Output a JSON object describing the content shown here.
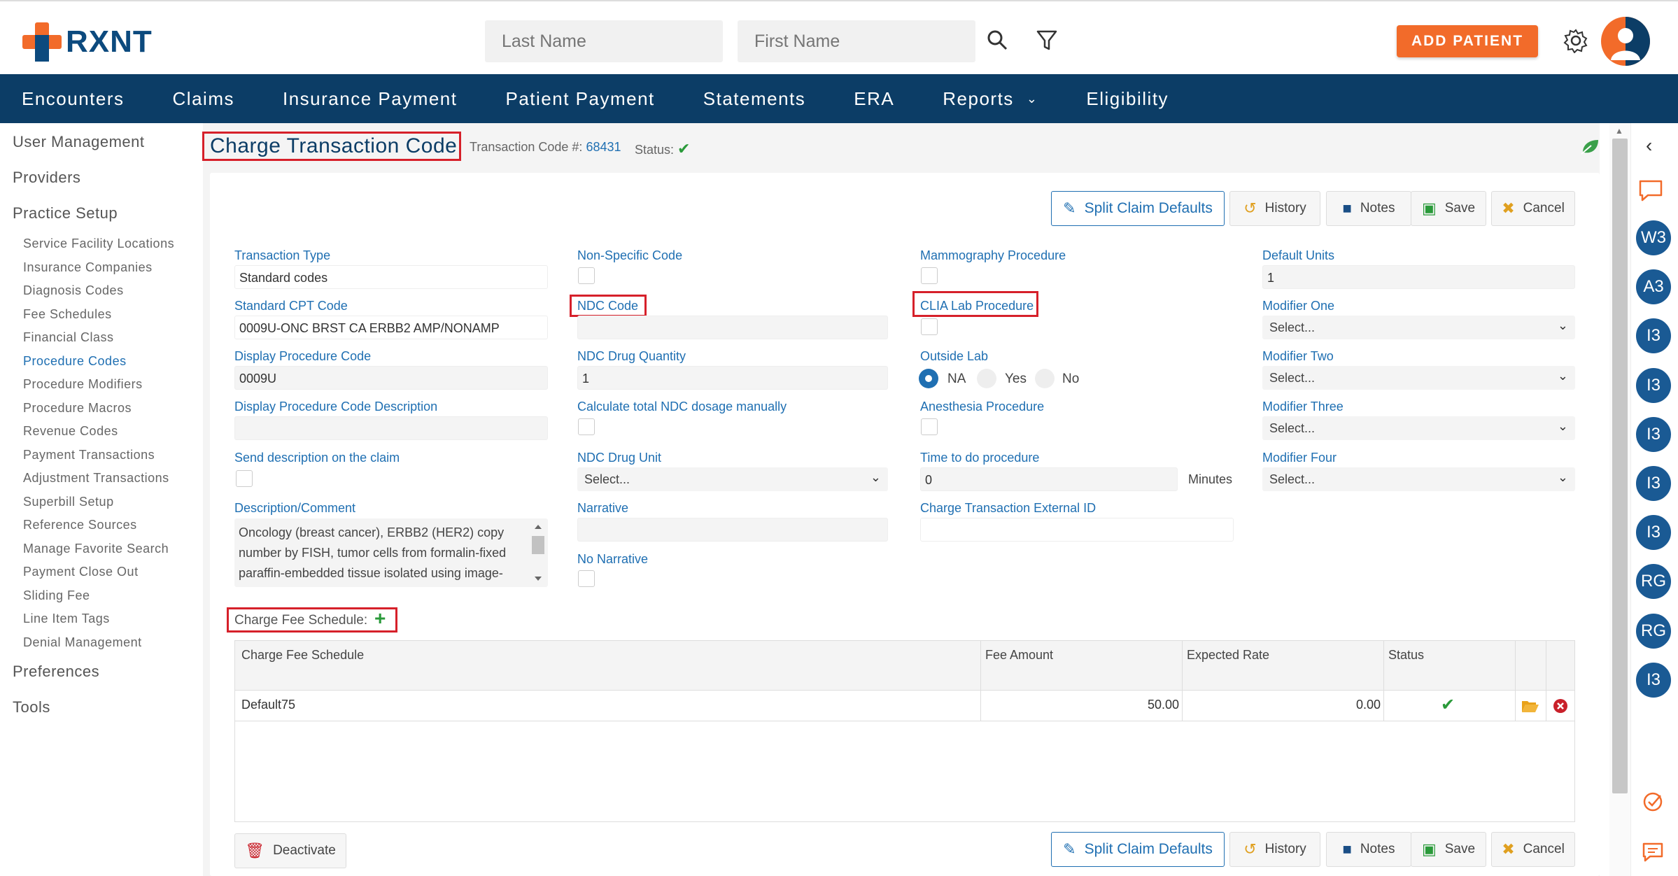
{
  "brand": {
    "name": "RXNT",
    "orange": "#f26b2a",
    "navy": "#0c3d66",
    "link_blue": "#1f6fb2"
  },
  "header": {
    "last_name_placeholder": "Last Name",
    "first_name_placeholder": "First Name",
    "add_patient_label": "ADD PATIENT",
    "icons": [
      "search-icon",
      "filter-icon",
      "gear-icon",
      "user-avatar-icon"
    ]
  },
  "nav": {
    "items": [
      {
        "label": "Encounters"
      },
      {
        "label": "Claims"
      },
      {
        "label": "Insurance Payment"
      },
      {
        "label": "Patient Payment"
      },
      {
        "label": "Statements"
      },
      {
        "label": "ERA"
      },
      {
        "label": "Reports",
        "dropdown": true
      },
      {
        "label": "Eligibility"
      }
    ]
  },
  "sidebar": {
    "sections": [
      {
        "label": "User Management"
      },
      {
        "label": "Providers"
      },
      {
        "label": "Practice Setup"
      }
    ],
    "practice_setup_items": [
      "Service Facility Locations",
      "Insurance Companies",
      "Diagnosis Codes",
      "Fee Schedules",
      "Financial Class",
      "Procedure Codes",
      "Procedure Modifiers",
      "Procedure Macros",
      "Revenue Codes",
      "Payment Transactions",
      "Adjustment Transactions",
      "Superbill Setup",
      "Reference Sources",
      "Manage Favorite Search",
      "Payment Close Out",
      "Sliding Fee",
      "Line Item Tags",
      "Denial Management"
    ],
    "active_item": "Procedure Codes",
    "bottom_sections": [
      {
        "label": "Preferences"
      },
      {
        "label": "Tools"
      }
    ]
  },
  "page": {
    "title": "Charge Transaction Code",
    "transaction_code_label": "Transaction Code #:",
    "transaction_code_value": "68431",
    "status_label": "Status:"
  },
  "actions": {
    "split_claim_defaults": "Split Claim Defaults",
    "history": "History",
    "notes": "Notes",
    "save": "Save",
    "cancel": "Cancel",
    "deactivate": "Deactivate"
  },
  "form": {
    "transaction_type": {
      "label": "Transaction Type",
      "value": "Standard codes"
    },
    "standard_cpt_code": {
      "label": "Standard CPT Code",
      "value": "0009U-ONC BRST CA ERBB2 AMP/NONAMP"
    },
    "display_procedure_code": {
      "label": "Display Procedure Code",
      "value": "0009U"
    },
    "display_procedure_code_description": {
      "label": "Display Procedure Code Description",
      "value": ""
    },
    "send_description": {
      "label": "Send description on the claim"
    },
    "description_comment": {
      "label": "Description/Comment",
      "value": "Oncology (breast cancer), ERBB2 (HER2) copy number by FISH, tumor cells from formalin-fixed paraffin-embedded tissue isolated using image-"
    },
    "non_specific_code": {
      "label": "Non-Specific Code"
    },
    "ndc_code": {
      "label": "NDC Code",
      "value": ""
    },
    "ndc_drug_quantity": {
      "label": "NDC Drug Quantity",
      "value": "1"
    },
    "calc_ndc": {
      "label": "Calculate total NDC dosage manually"
    },
    "ndc_drug_unit": {
      "label": "NDC Drug Unit",
      "value": "Select..."
    },
    "narrative": {
      "label": "Narrative",
      "value": ""
    },
    "no_narrative": {
      "label": "No Narrative"
    },
    "mammography": {
      "label": "Mammography Procedure"
    },
    "clia": {
      "label": "CLIA Lab Procedure"
    },
    "outside_lab": {
      "label": "Outside Lab",
      "options": [
        "NA",
        "Yes",
        "No"
      ],
      "selected": "NA"
    },
    "anesthesia": {
      "label": "Anesthesia Procedure"
    },
    "time_to_do": {
      "label": "Time to do procedure",
      "value": "0",
      "unit": "Minutes"
    },
    "external_id": {
      "label": "Charge Transaction External ID",
      "value": ""
    },
    "default_units": {
      "label": "Default Units",
      "value": "1"
    },
    "modifier_one": {
      "label": "Modifier One",
      "value": "Select..."
    },
    "modifier_two": {
      "label": "Modifier Two",
      "value": "Select..."
    },
    "modifier_three": {
      "label": "Modifier Three",
      "value": "Select..."
    },
    "modifier_four": {
      "label": "Modifier Four",
      "value": "Select..."
    }
  },
  "fee_schedule": {
    "label": "Charge Fee Schedule:",
    "columns": [
      "Charge Fee Schedule",
      "Fee Amount",
      "Expected Rate",
      "Status"
    ],
    "rows": [
      {
        "name": "Default75",
        "fee_amount": "50.00",
        "expected_rate": "0.00"
      }
    ]
  },
  "right_rail": {
    "bubbles": [
      "W3",
      "A3",
      "I3",
      "I3",
      "I3",
      "I3",
      "I3",
      "RG",
      "RG",
      "I3"
    ]
  }
}
